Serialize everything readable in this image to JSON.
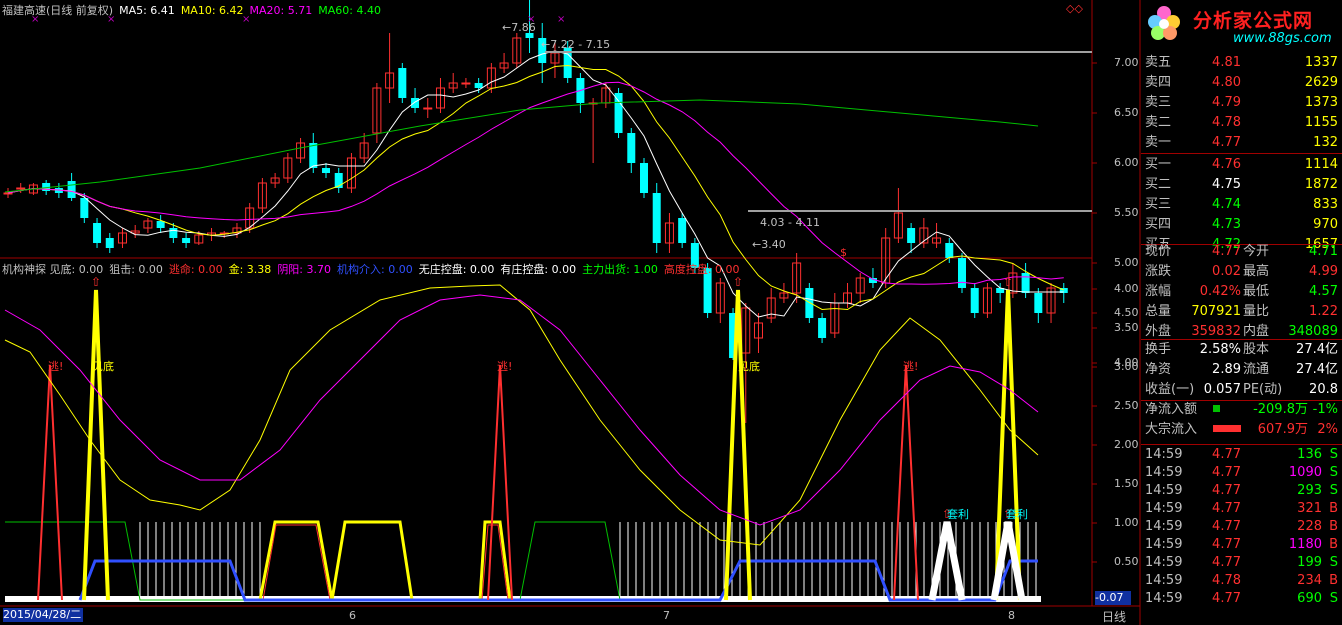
{
  "main": {
    "legend": [
      {
        "text": "福建高速(日线 前复权)",
        "color": "#c0c0c0"
      },
      {
        "text": "MA5: 6.41",
        "color": "#ffffff"
      },
      {
        "text": "MA10: 6.42",
        "color": "#ffff00"
      },
      {
        "text": "MA20: 5.71",
        "color": "#ff00ff"
      },
      {
        "text": "MA60: 4.40",
        "color": "#00ff00"
      }
    ],
    "price_ticks": [
      "7.00",
      "6.50",
      "6.00",
      "5.50",
      "5.00",
      "4.50",
      "4.00"
    ],
    "annotations": {
      "high": "7.86",
      "range_high": "7.22 - 7.15",
      "range_low": "4.03 - 4.11",
      "low": "3.40"
    }
  },
  "indicator": {
    "legend": [
      {
        "text": "机构神探 见底: 0.00",
        "color": "#c0c0c0"
      },
      {
        "text": "狙击: 0.00",
        "color": "#c0c0c0"
      },
      {
        "text": "逃命: 0.00",
        "color": "#ff3030"
      },
      {
        "text": "金: 3.38",
        "color": "#ffff00"
      },
      {
        "text": "阴阳: 3.70",
        "color": "#ff00ff"
      },
      {
        "text": "机构介入: 0.00",
        "color": "#3050ff"
      },
      {
        "text": "无庄控盘: 0.00",
        "color": "#ffffff"
      },
      {
        "text": "有庄控盘: 0.00",
        "color": "#ffffff"
      },
      {
        "text": "主力出货: 1.00",
        "color": "#00ff00"
      },
      {
        "text": "高度控盘: 0.00",
        "color": "#ff3030"
      }
    ],
    "ticks": [
      "4.00",
      "3.50",
      "3.00",
      "2.50",
      "2.00",
      "1.50",
      "1.00",
      "0.50"
    ],
    "labels": {
      "bottom1": "见底",
      "bottom2": "见底",
      "escape1": "逃!",
      "escape2": "逃!",
      "escape3": "逃!",
      "profit1": "套利",
      "profit2": "套利"
    },
    "current_value": "-0.07"
  },
  "axis": {
    "date": "2015/04/28/二",
    "m6": "6",
    "m7": "7",
    "m8": "8",
    "period": "日线"
  },
  "side": {
    "logo": "分析家公式网",
    "url": "www.88gs.com",
    "orderbook": [
      {
        "label": "卖五",
        "price": "4.81",
        "vol": "1337",
        "pc": "#ff3030"
      },
      {
        "label": "卖四",
        "price": "4.80",
        "vol": "2629",
        "pc": "#ff3030"
      },
      {
        "label": "卖三",
        "price": "4.79",
        "vol": "1373",
        "pc": "#ff3030"
      },
      {
        "label": "卖二",
        "price": "4.78",
        "vol": "1155",
        "pc": "#ff3030"
      },
      {
        "label": "卖一",
        "price": "4.77",
        "vol": "132",
        "pc": "#ff3030"
      },
      {
        "label": "买一",
        "price": "4.76",
        "vol": "1114",
        "pc": "#ff3030"
      },
      {
        "label": "买二",
        "price": "4.75",
        "vol": "1872",
        "pc": "#ffffff"
      },
      {
        "label": "买三",
        "price": "4.74",
        "vol": "833",
        "pc": "#00ff00"
      },
      {
        "label": "买四",
        "price": "4.73",
        "vol": "970",
        "pc": "#00ff00"
      },
      {
        "label": "买五",
        "price": "4.72",
        "vol": "1657",
        "pc": "#00ff00"
      }
    ],
    "stats": [
      {
        "l1": "现价",
        "v1": "4.77",
        "c1": "#ff3030",
        "l2": "今开",
        "v2": "4.71",
        "c2": "#00ff00"
      },
      {
        "l1": "涨跌",
        "v1": "0.02",
        "c1": "#ff3030",
        "l2": "最高",
        "v2": "4.99",
        "c2": "#ff3030"
      },
      {
        "l1": "涨幅",
        "v1": "0.42%",
        "c1": "#ff3030",
        "l2": "最低",
        "v2": "4.57",
        "c2": "#00ff00"
      },
      {
        "l1": "总量",
        "v1": "707921",
        "c1": "#ffff00",
        "l2": "量比",
        "v2": "1.22",
        "c2": "#ff3030"
      },
      {
        "l1": "外盘",
        "v1": "359832",
        "c1": "#ff3030",
        "l2": "内盘",
        "v2": "348089",
        "c2": "#00ff00"
      }
    ],
    "stats2": [
      {
        "l1": "换手",
        "v1": "2.58%",
        "c1": "#ffffff",
        "l2": "股本",
        "v2": "27.4亿",
        "c2": "#ffffff"
      },
      {
        "l1": "净资",
        "v1": "2.89",
        "c1": "#ffffff",
        "l2": "流通",
        "v2": "27.4亿",
        "c2": "#ffffff"
      },
      {
        "l1": "收益(一)",
        "v1": "0.057",
        "c1": "#ffffff",
        "l2": "PE(动)",
        "v2": "20.8",
        "c2": "#ffffff"
      }
    ],
    "flows": [
      {
        "label": "净流入额",
        "value": "-209.8万",
        "pct": "-1%",
        "color": "#00ff00"
      },
      {
        "label": "大宗流入",
        "value": "607.9万",
        "pct": "2%",
        "color": "#ff3030"
      }
    ],
    "ticks": [
      {
        "time": "14:59",
        "price": "4.77",
        "vol": "136",
        "side": "S",
        "vc": "#00ff00"
      },
      {
        "time": "14:59",
        "price": "4.77",
        "vol": "1090",
        "side": "S",
        "vc": "#ff00ff"
      },
      {
        "time": "14:59",
        "price": "4.77",
        "vol": "293",
        "side": "S",
        "vc": "#00ff00"
      },
      {
        "time": "14:59",
        "price": "4.77",
        "vol": "321",
        "side": "B",
        "vc": "#ff3030"
      },
      {
        "time": "14:59",
        "price": "4.77",
        "vol": "228",
        "side": "B",
        "vc": "#ff3030"
      },
      {
        "time": "14:59",
        "price": "4.77",
        "vol": "1180",
        "side": "B",
        "vc": "#ff00ff"
      },
      {
        "time": "14:59",
        "price": "4.77",
        "vol": "199",
        "side": "S",
        "vc": "#00ff00"
      },
      {
        "time": "14:59",
        "price": "4.78",
        "vol": "234",
        "side": "B",
        "vc": "#ff3030"
      },
      {
        "time": "14:59",
        "price": "4.77",
        "vol": "690",
        "side": "S",
        "vc": "#00ff00"
      }
    ]
  }
}
